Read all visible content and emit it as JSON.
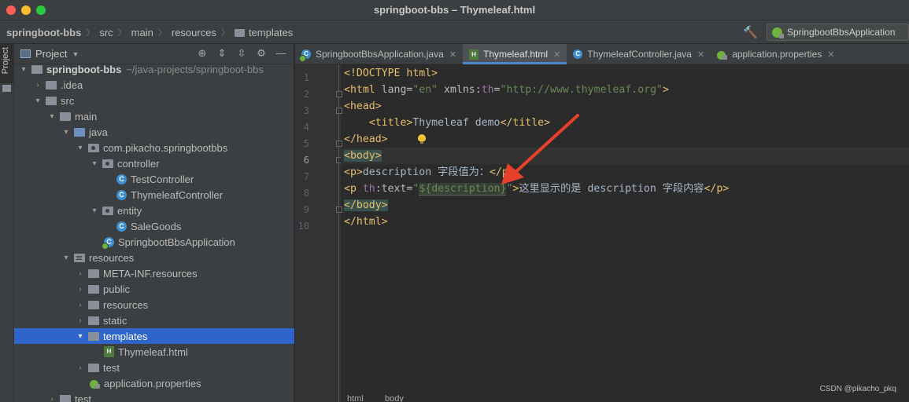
{
  "window": {
    "title": "springboot-bbs – Thymeleaf.html"
  },
  "navbar": {
    "crumbs": [
      "springboot-bbs",
      "src",
      "main",
      "resources",
      "templates"
    ],
    "run_config": "SpringbootBbsApplication"
  },
  "stripe": {
    "label": "Project"
  },
  "project_panel": {
    "title": "Project",
    "tree": [
      {
        "label": "springboot-bbs",
        "path": "~/java-projects/springboot-bbs",
        "icon": "folder-icon",
        "expanded": true
      },
      {
        "label": ".idea",
        "icon": "folder-icon",
        "expanded": false
      },
      {
        "label": "src",
        "icon": "folder-icon",
        "expanded": true
      },
      {
        "label": "main",
        "icon": "folder-icon",
        "expanded": true
      },
      {
        "label": "java",
        "icon": "source-folder-icon",
        "expanded": true
      },
      {
        "label": "com.pikacho.springbootbbs",
        "icon": "package-icon",
        "expanded": true
      },
      {
        "label": "controller",
        "icon": "package-icon",
        "expanded": true
      },
      {
        "label": "TestController",
        "icon": "class-icon"
      },
      {
        "label": "ThymeleafController",
        "icon": "class-icon"
      },
      {
        "label": "entity",
        "icon": "package-icon",
        "expanded": true
      },
      {
        "label": "SaleGoods",
        "icon": "class-icon"
      },
      {
        "label": "SpringbootBbsApplication",
        "icon": "spring-boot-class-icon"
      },
      {
        "label": "resources",
        "icon": "resources-folder-icon",
        "expanded": true
      },
      {
        "label": "META-INF.resources",
        "icon": "folder-icon",
        "expanded": false
      },
      {
        "label": "public",
        "icon": "folder-icon",
        "expanded": false
      },
      {
        "label": "resources",
        "icon": "folder-icon",
        "expanded": false
      },
      {
        "label": "static",
        "icon": "folder-icon",
        "expanded": false
      },
      {
        "label": "templates",
        "icon": "folder-icon",
        "expanded": true,
        "selected": true
      },
      {
        "label": "Thymeleaf.html",
        "icon": "html-file-icon"
      },
      {
        "label": "test",
        "icon": "folder-icon",
        "expanded": false
      },
      {
        "label": "application.properties",
        "icon": "properties-file-icon"
      },
      {
        "label": "test",
        "icon": "folder-icon",
        "expanded": false
      }
    ]
  },
  "editor": {
    "tabs": [
      {
        "label": "SpringbootBbsApplication.java",
        "icon": "class-icon",
        "active": false
      },
      {
        "label": "Thymeleaf.html",
        "icon": "html-file-icon",
        "active": true
      },
      {
        "label": "ThymeleafController.java",
        "icon": "class-icon",
        "active": false
      },
      {
        "label": "application.properties",
        "icon": "properties-file-icon",
        "active": false
      }
    ],
    "line_numbers": [
      "1",
      "2",
      "3",
      "4",
      "5",
      "6",
      "7",
      "8",
      "9",
      "10"
    ],
    "current_line": "6",
    "code": {
      "l1": "<!DOCTYPE html>",
      "l2_open": "<html",
      "l2_attr1": " lang=",
      "l2_val1": "\"en\"",
      "l2_ns": " xmlns:",
      "l2_th": "th",
      "l2_eq": "=",
      "l2_val2": "\"http://www.thymeleaf.org\"",
      "l2_close": ">",
      "l3": "<head>",
      "l4_indent": "    ",
      "l4_open": "<title>",
      "l4_text": "Thymeleaf demo",
      "l4_close": "</title>",
      "l5": "</head>",
      "l6": "<body>",
      "l7_open": "<p>",
      "l7_text": "description 字段值为：",
      "l7_close": "</p>",
      "l8_open": "<p",
      "l8_th": " th",
      "l8_attr": ":text=",
      "l8_q1": "\"",
      "l8_expr": "${description}",
      "l8_q2": "\"",
      "l8_gt": ">",
      "l8_text": "这里显示的是 description 字段内容",
      "l8_close": "</p>",
      "l9": "</body>",
      "l10": "</html>"
    },
    "breadcrumb": [
      "html",
      "body"
    ]
  },
  "watermark": "CSDN @pikacho_pkq",
  "colors": {
    "annotation_arrow": "#e8402b",
    "selection": "#2f65ca",
    "tag": "#e8bf6a",
    "string": "#6a8759"
  }
}
